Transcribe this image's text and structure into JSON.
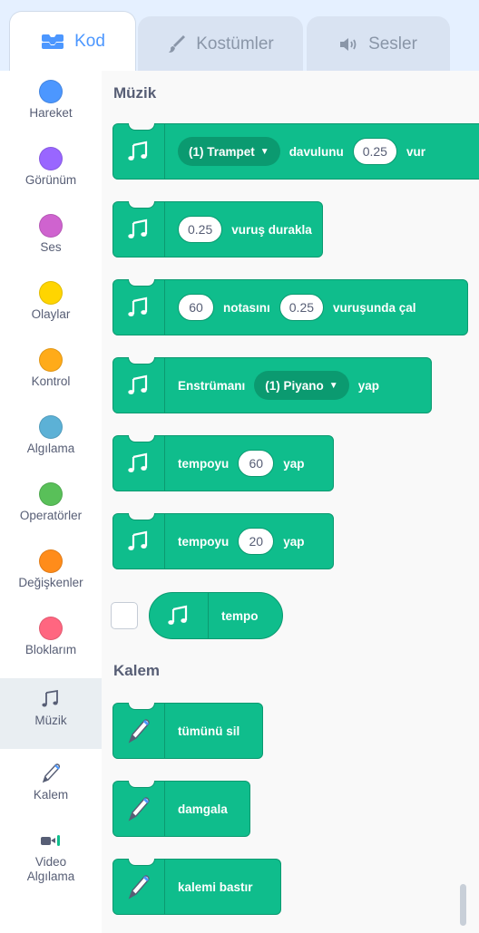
{
  "tabs": [
    {
      "label": "Kod",
      "icon": "code-icon",
      "active": true
    },
    {
      "label": "Kostümler",
      "icon": "brush-icon",
      "active": false
    },
    {
      "label": "Sesler",
      "icon": "speaker-icon",
      "active": false
    }
  ],
  "categories": [
    {
      "label": "Hareket",
      "color": "#4c97ff"
    },
    {
      "label": "Görünüm",
      "color": "#9966ff"
    },
    {
      "label": "Ses",
      "color": "#cf63cf"
    },
    {
      "label": "Olaylar",
      "color": "#ffd500"
    },
    {
      "label": "Kontrol",
      "color": "#ffab19"
    },
    {
      "label": "Algılama",
      "color": "#5cb1d6"
    },
    {
      "label": "Operatörler",
      "color": "#59c059"
    },
    {
      "label": "Değişkenler",
      "color": "#ff8c1a"
    },
    {
      "label": "Bloklarım",
      "color": "#ff6680"
    },
    {
      "label": "Müzik",
      "icon": "music-notes-icon",
      "selected": true
    },
    {
      "label": "Kalem",
      "icon": "pen-icon"
    },
    {
      "label": "Video\nAlgılama",
      "icon": "video-camera-icon"
    }
  ],
  "sections": {
    "music_title": "Müzik",
    "pen_title": "Kalem"
  },
  "music_blocks": {
    "drum": {
      "drop": "(1) Trampet",
      "text1": "davulunu",
      "value": "0.25",
      "text2": "vur"
    },
    "rest": {
      "value": "0.25",
      "text": "vuruş durakla"
    },
    "note": {
      "value1": "60",
      "text1": "notasını",
      "value2": "0.25",
      "text2": "vuruşunda çal"
    },
    "instrument": {
      "text1": "Enstrümanı",
      "drop": "(1) Piyano",
      "text2": "yap"
    },
    "tempo_set": {
      "text1": "tempoyu",
      "value": "60",
      "text2": "yap"
    },
    "tempo_change": {
      "text1": "tempoyu",
      "value": "20",
      "text2": "yap"
    },
    "tempo_reporter": {
      "text": "tempo"
    }
  },
  "pen_blocks": {
    "clear": "tümünü sil",
    "stamp": "damgala",
    "pen_down": "kalemi bastır"
  },
  "colors": {
    "music": "#0fbd8c",
    "music_dark": "#0b9a70",
    "accent": "#4c97ff"
  }
}
